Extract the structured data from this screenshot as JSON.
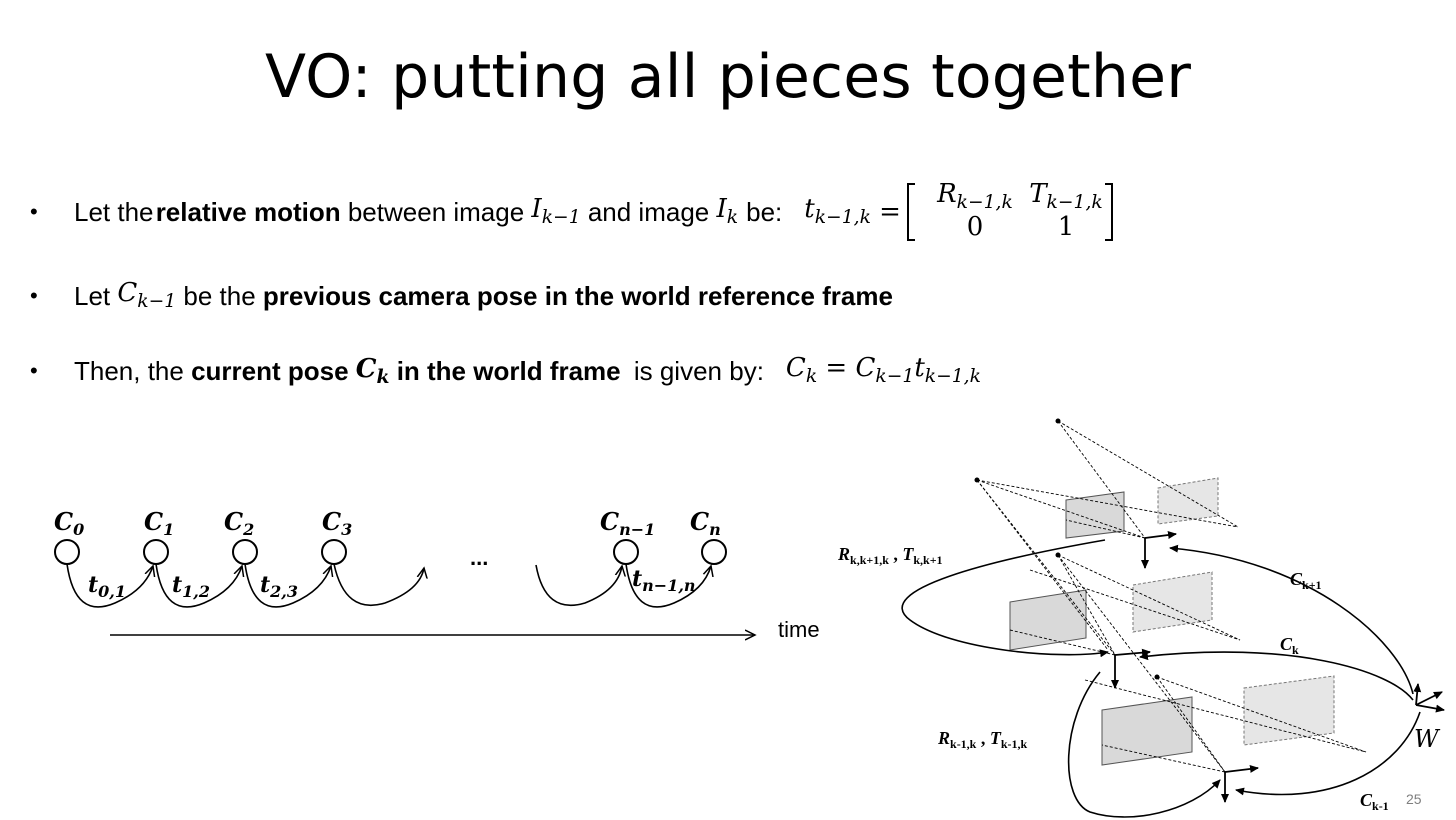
{
  "slide": {
    "title": "VO: putting all pieces together",
    "page_number": "25"
  },
  "bullets": {
    "b1": {
      "prefix": "Let the ",
      "bold": "relative motion",
      "mid": " between image ",
      "img1": "I",
      "img1_sub": "k−1",
      "and": " and image ",
      "img2": "I",
      "img2_sub": "k",
      "suffix": " be:",
      "eq_lhs": "t",
      "eq_lhs_sub": "k−1,k",
      "eq": " =",
      "m11": "R",
      "m11_sub": "k−1,k",
      "m12": "T",
      "m12_sub": "k−1,k",
      "m21": "0",
      "m22": "1"
    },
    "b2": {
      "prefix": "Let ",
      "var": "C",
      "var_sub": "k−1",
      "mid": " be the ",
      "bold": "previous camera pose in the world reference frame"
    },
    "b3": {
      "prefix": "Then, the ",
      "bold1": "current pose ",
      "bold_var": "C",
      "bold_var_sub": "k",
      "bold2": " in the world frame",
      "suffix": " is given by:",
      "eq_lhs": "C",
      "eq_lhs_sub": "k",
      "eq": " = ",
      "rhs1": "C",
      "rhs1_sub": "k−1",
      "rhs2": "t",
      "rhs2_sub": "k−1,k"
    }
  },
  "timeline": {
    "nodes": [
      {
        "label": "C",
        "sub": "0"
      },
      {
        "label": "C",
        "sub": "1"
      },
      {
        "label": "C",
        "sub": "2"
      },
      {
        "label": "C",
        "sub": "3"
      },
      {
        "label": "C",
        "sub": "n−1"
      },
      {
        "label": "C",
        "sub": "n"
      }
    ],
    "edges": [
      {
        "label": "t",
        "sub": "0,1"
      },
      {
        "label": "t",
        "sub": "1,2"
      },
      {
        "label": "t",
        "sub": "2,3"
      },
      {
        "label": "t",
        "sub": "n−1,n"
      }
    ],
    "ellipsis": "...",
    "axis_label": "time"
  },
  "diagram": {
    "labels": {
      "upper_rel": "R",
      "upper_rel_sub": "k,k+1,k",
      "upper_sep": " , ",
      "upper_T": "T",
      "upper_T_sub": "k,k+1",
      "lower_rel": "R",
      "lower_rel_sub": "k-1,k",
      "lower_sep": " , ",
      "lower_T": "T",
      "lower_T_sub": "k-1,k",
      "c_next": "C",
      "c_next_sub": "k+1",
      "c_curr": "C",
      "c_curr_sub": "k",
      "c_prev": "C",
      "c_prev_sub": "k-1",
      "world": "W"
    }
  }
}
